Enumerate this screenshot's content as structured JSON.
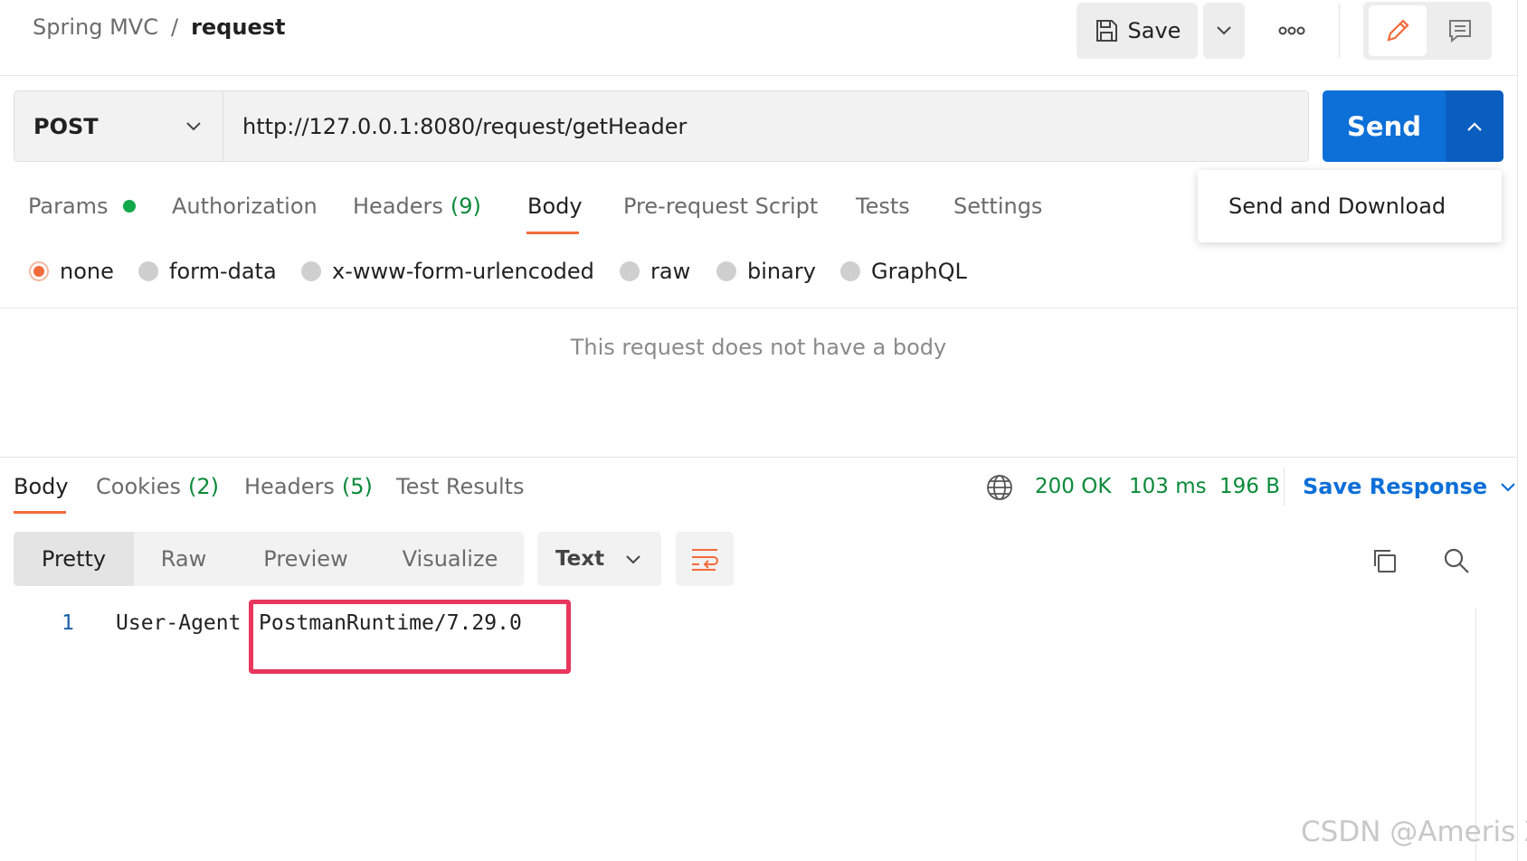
{
  "breadcrumb": {
    "parent": "Spring MVC",
    "separator": "/",
    "current": "request"
  },
  "toolbar": {
    "save_label": "Save"
  },
  "request": {
    "method": "POST",
    "url": "http://127.0.0.1:8080/request/getHeader",
    "send_label": "Send",
    "send_menu": [
      "Send and Download"
    ]
  },
  "request_tabs": {
    "params": "Params",
    "authorization": "Authorization",
    "headers": "Headers",
    "headers_count": "(9)",
    "body": "Body",
    "prerequest": "Pre-request Script",
    "tests": "Tests",
    "settings": "Settings"
  },
  "body_types": {
    "none": "none",
    "form_data": "form-data",
    "urlencoded": "x-www-form-urlencoded",
    "raw": "raw",
    "binary": "binary",
    "graphql": "GraphQL"
  },
  "empty_body_message": "This request does not have a body",
  "response_tabs": {
    "body": "Body",
    "cookies": "Cookies",
    "cookies_count": "(2)",
    "headers": "Headers",
    "headers_count": "(5)",
    "test_results": "Test Results"
  },
  "response_status": {
    "status": "200 OK",
    "time": "103 ms",
    "size": "196 B"
  },
  "save_response_label": "Save Response",
  "view_modes": {
    "pretty": "Pretty",
    "raw": "Raw",
    "preview": "Preview",
    "visualize": "Visualize"
  },
  "format": "Text",
  "response_body": [
    {
      "line": "1",
      "key": "User-Agent",
      "value": "PostmanRuntime/7.29.0"
    }
  ],
  "watermark": "CSDN @Ameris Z",
  "colors": {
    "accent": "#f26b3a",
    "send": "#0d6fd8",
    "status": "#0a8a3a",
    "highlight": "#e8365d"
  }
}
